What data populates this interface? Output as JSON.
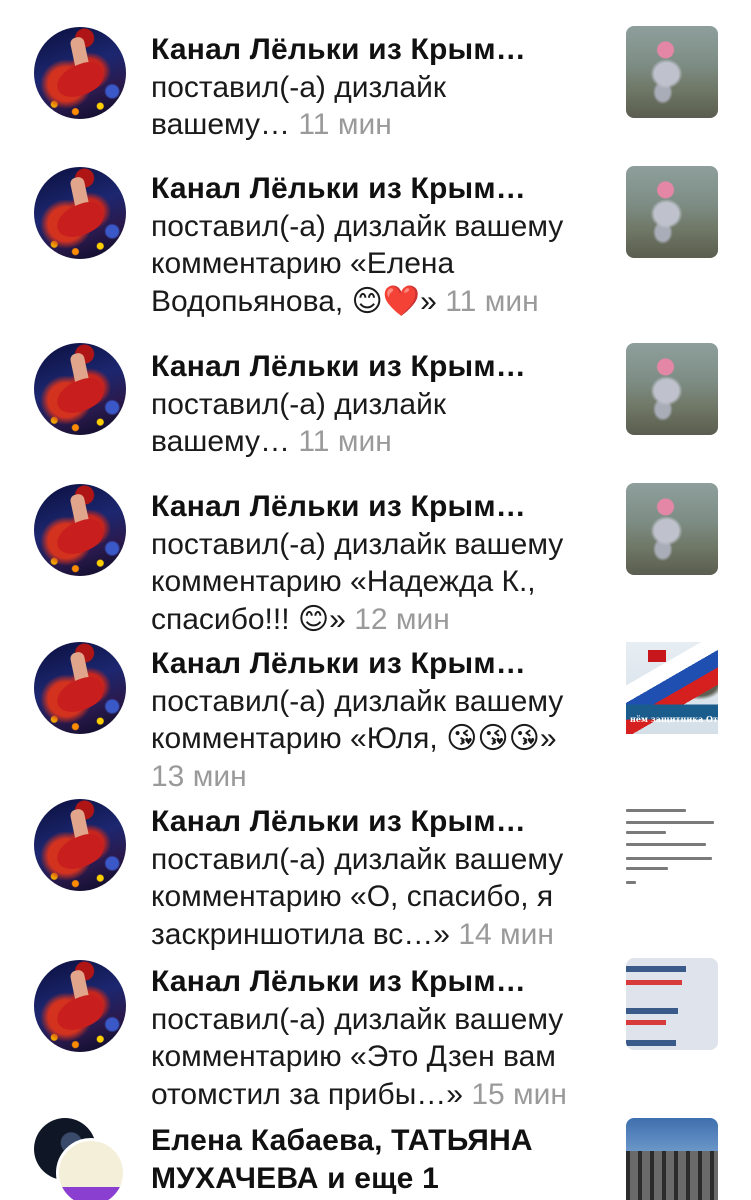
{
  "notifications": [
    {
      "title": "Канал Лёльки из Крым…",
      "lines": [
        "поставил(-а) дизлайк",
        "вашему…"
      ],
      "time": "11 мин",
      "thumb": "beach-photo"
    },
    {
      "title": "Канал Лёльки из Крым…",
      "lines": [
        "поставил(-а) дизлайк вашему",
        "комментарию «Елена",
        "Водопьянова, 😊❤️»"
      ],
      "time": "11 мин",
      "thumb": "beach-photo"
    },
    {
      "title": "Канал Лёльки из Крым…",
      "lines": [
        "поставил(-а) дизлайк",
        "вашему…"
      ],
      "time": "11 мин",
      "thumb": "beach-photo"
    },
    {
      "title": "Канал Лёльки из Крым…",
      "lines": [
        "поставил(-а) дизлайк вашему",
        "комментарию «Надежда К.,",
        "спасибо!!! 😊»"
      ],
      "time": "12 мин",
      "thumb": "beach-photo"
    },
    {
      "title": "Канал Лёльки из Крым…",
      "lines": [
        "поставил(-а) дизлайк вашему",
        "комментарию «Юля, 😘😘😘»"
      ],
      "time": "13 мин",
      "thumb": "defender-day-poster",
      "thumb_caption": "нём защитника Отечест"
    },
    {
      "title": "Канал Лёльки из Крым…",
      "lines": [
        "поставил(-а) дизлайк вашему",
        "комментарию «О, спасибо, я",
        "заскриншотила вс…»"
      ],
      "time": "14 мин",
      "thumb": "comment-screenshot"
    },
    {
      "title": "Канал Лёльки из Крым…",
      "lines": [
        "поставил(-а) дизлайк вашему",
        "комментарию «Это Дзен вам",
        "отомстил за прибы…»"
      ],
      "time": "15 мин",
      "thumb": "stats-screenshot"
    },
    {
      "title": "Елена Кабаева, ТАТЬЯНА",
      "title2": "МУХАЧЕВА и еще 1",
      "thumb": "building-photo"
    }
  ],
  "colors": {
    "title": "#111111",
    "body": "#1a1a1a",
    "time": "#9a9a9a",
    "background": "#ffffff"
  }
}
